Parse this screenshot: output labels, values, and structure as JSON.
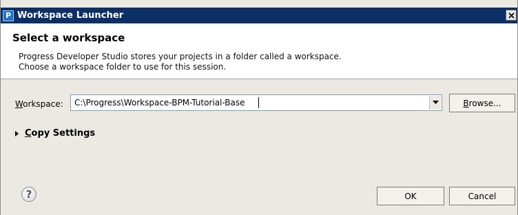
{
  "window": {
    "title": "Workspace Launcher",
    "icon": "P"
  },
  "header": {
    "title": "Select a workspace",
    "description_lines": [
      "Progress Developer Studio stores your projects in a folder called a workspace.",
      "Choose a workspace folder to use for this session."
    ]
  },
  "workspace": {
    "label_mnemonic": "W",
    "label_rest": "orkspace:",
    "value": "C:\\Progress\\Workspace-BPM-Tutorial-Base",
    "browse_mnemonic": "B",
    "browse_rest": "rowse..."
  },
  "copy_settings": {
    "label_mnemonic": "C",
    "label_rest": "opy Settings"
  },
  "footer": {
    "help_glyph": "?",
    "ok_label": "OK",
    "cancel_label": "Cancel"
  },
  "icons": {
    "close": "close-icon",
    "dropdown": "chevron-down-icon",
    "help": "help-icon",
    "expand": "expand-triangle-icon"
  }
}
